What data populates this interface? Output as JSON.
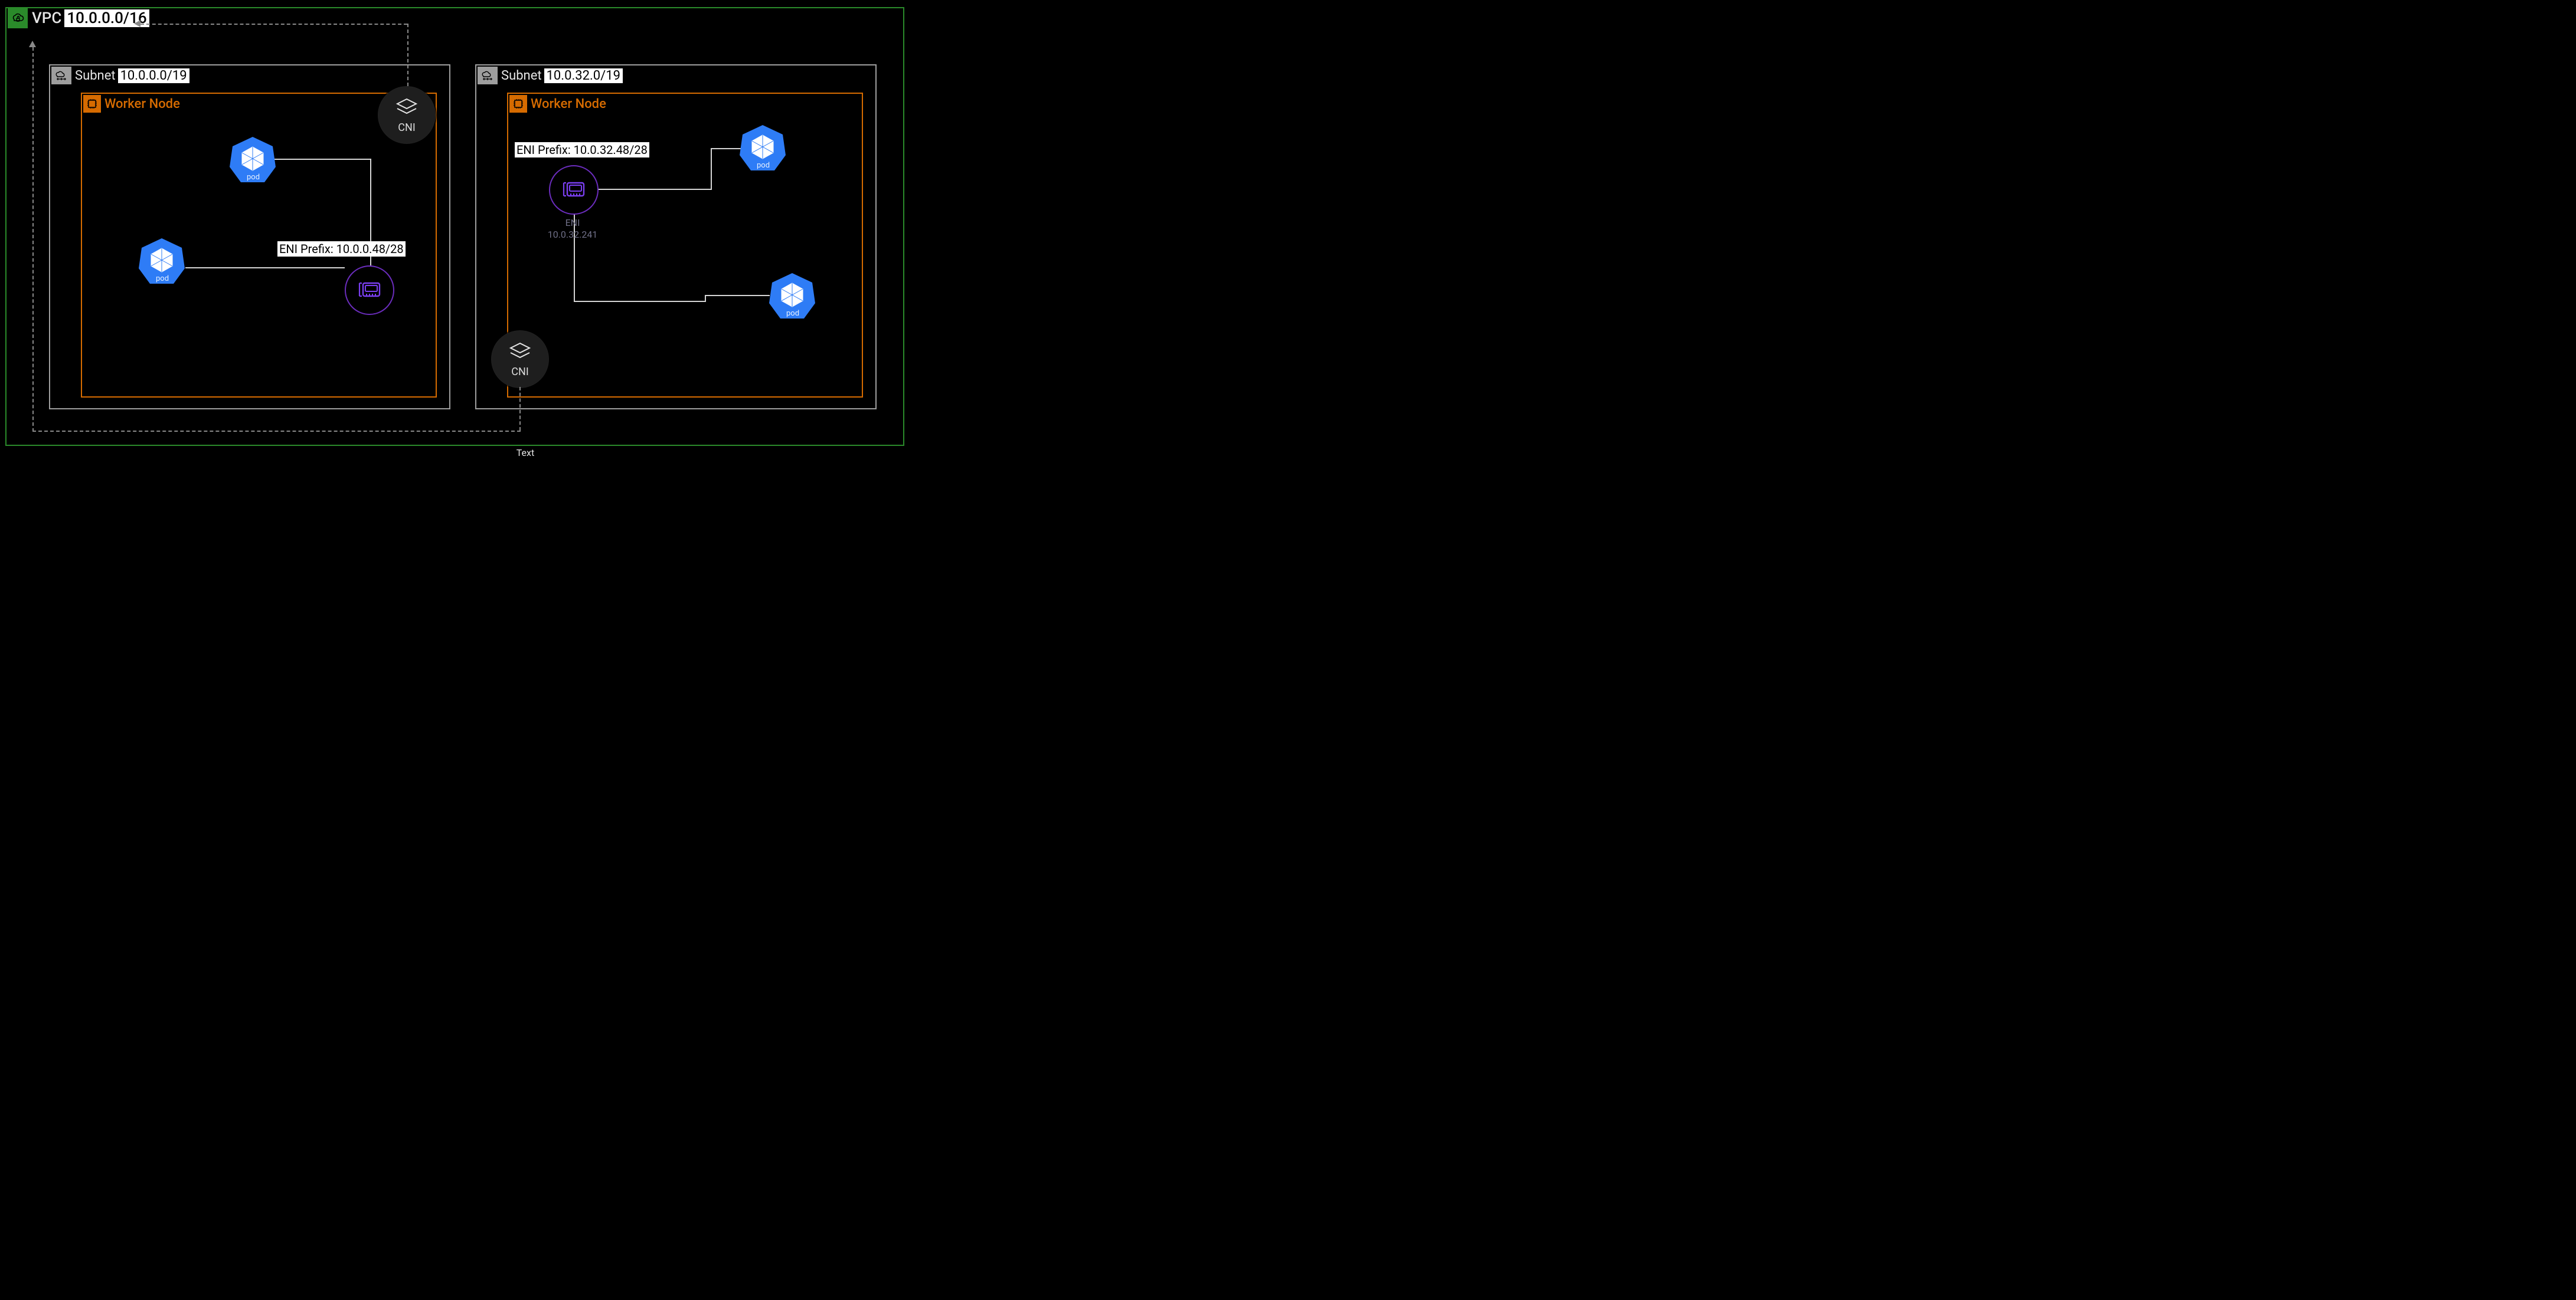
{
  "vpc": {
    "title": "VPC",
    "cidr": "10.0.0.0/16"
  },
  "subnet1": {
    "title": "Subnet",
    "cidr": "10.0.0.0/19"
  },
  "subnet2": {
    "title": "Subnet",
    "cidr": "10.0.32.0/19"
  },
  "worker_label": "Worker Node",
  "cni_label": "CNI",
  "pod_label": "pod",
  "eni1_prefix_key": "ENI Prefix:",
  "eni1_prefix_val": "10.0.0.48/28",
  "eni2_prefix_key": "ENI Prefix:",
  "eni2_prefix_val": "10.0.32.48/28",
  "eni2_name": "ENI",
  "eni2_ip": "10.0.32.241",
  "footer_text": "Text"
}
